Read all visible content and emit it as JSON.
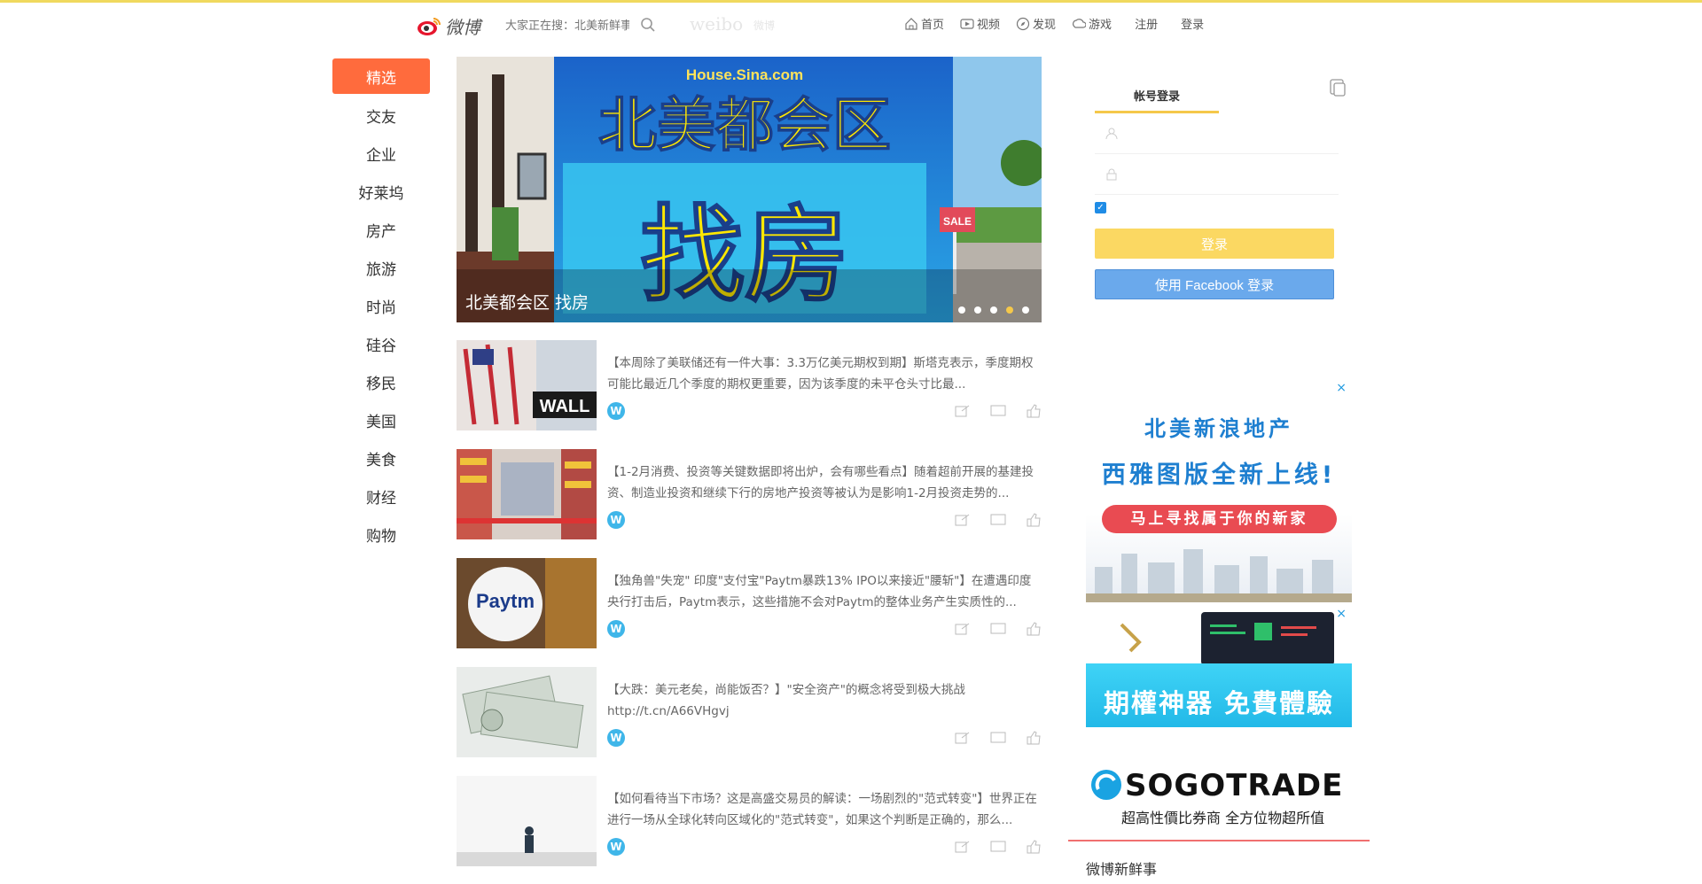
{
  "header": {
    "logo_text": "微博",
    "search_placeholder": "大家正在搜：北美新鲜事",
    "weibo_word": "weibo",
    "weibo_sub": "微博",
    "nav": [
      {
        "label": "首页",
        "icon": "home-icon"
      },
      {
        "label": "视频",
        "icon": "video-icon"
      },
      {
        "label": "发现",
        "icon": "discover-icon"
      },
      {
        "label": "游戏",
        "icon": "game-icon"
      },
      {
        "label": "注册",
        "icon": ""
      },
      {
        "label": "登录",
        "icon": ""
      }
    ]
  },
  "sidenav": {
    "items": [
      "精选",
      "交友",
      "企业",
      "好莱坞",
      "房产",
      "旅游",
      "时尚",
      "硅谷",
      "移民",
      "美国",
      "美食",
      "财经",
      "购物"
    ],
    "active_index": 0
  },
  "banner": {
    "site": "House.Sina.com",
    "headline": "北美都会区",
    "big_text": "找房",
    "sale_sign": "SALE",
    "caption": "北美都会区 找房",
    "dots": 5,
    "active_dot": 3
  },
  "feed": [
    {
      "text": "【本周除了美联储还有一件大事：3.3万亿美元期权到期】斯塔克表示，季度期权可能比最近几个季度的期权更重要，因为该季度的未平仓头寸比最...",
      "thumb": "wall-street",
      "thumb_text": "WALL"
    },
    {
      "text": "【1-2月消费、投资等关键数据即将出炉，会有哪些看点】随着超前开展的基建投资、制造业投资和继续下行的房地产投资等被认为是影响1-2月投资走势的...",
      "thumb": "supermarket",
      "thumb_text": ""
    },
    {
      "text": "【独角兽\"失宠\" 印度\"支付宝\"Paytm暴跌13% IPO以来接近\"腰斩\"】在遭遇印度央行打击后，Paytm表示，这些措施不会对Paytm的整体业务产生实质性的...",
      "thumb": "paytm",
      "thumb_text": "Paytm"
    },
    {
      "text": "【大跌：美元老矣，尚能饭否？】\"安全资产\"的概念将受到极大挑战 http://t.cn/A66VHgvj",
      "thumb": "dollars",
      "thumb_text": ""
    },
    {
      "text": "【如何看待当下市场？这是高盛交易员的解读：一场剧烈的\"范式转变\"】世界正在进行一场从全球化转向区域化的\"范式转变\"，如果这个判断是正确的，那么...",
      "thumb": "person",
      "thumb_text": ""
    }
  ],
  "login": {
    "tab_label": "帐号登录",
    "login_button": "登录",
    "facebook_button": "使用 Facebook 登录"
  },
  "ads": {
    "ad1_line1": "北美新浪地产",
    "ad1_line2": "西雅图版全新上线!",
    "ad1_pill": "马上寻找属于你的新家",
    "ad2_headline": "期權神器 免費體驗",
    "ad2_brand": "SOGOTRADE",
    "ad2_tagline": "超高性價比券商 全方位物超所值",
    "close": "×"
  },
  "section_title": "微博新鲜事",
  "colors": {
    "accent": "#ff6b3d",
    "login_yellow": "#fbd862",
    "facebook_blue": "#6aa9ec",
    "weibo_badge": "#3fb6e9"
  }
}
